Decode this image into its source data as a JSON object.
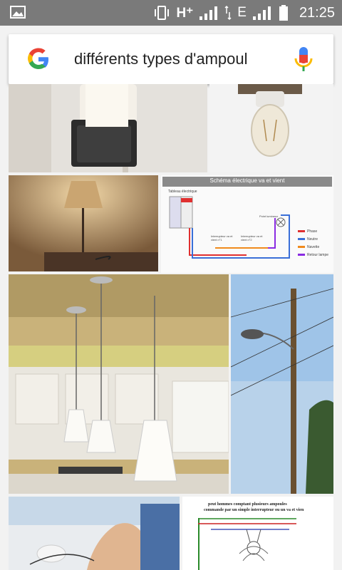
{
  "status_bar": {
    "network_label": "H⁺",
    "network_label2": "E",
    "time": "21:25",
    "icons": [
      "gallery-notification-icon",
      "vibrate-icon",
      "signal-icon",
      "data-arrows-icon",
      "battery-icon"
    ]
  },
  "search": {
    "query": "différents types d'ampoul",
    "logo_icon": "google-g-icon",
    "voice_icon": "microphone-icon"
  },
  "results": {
    "diagram1": {
      "title": "Schéma électrique va et vient",
      "panel_label": "Tableau électrique",
      "point_label": "Point lumineux",
      "switch1_label": "Interrupteur va et vient n°1",
      "switch2_label": "Interrupteur va et vient n°2",
      "legend": [
        "Phase",
        "Neutre",
        "Navette",
        "Retour lampe"
      ],
      "legend_colors": [
        "#e03030",
        "#3a6fd8",
        "#f08a1c",
        "#8a2be2"
      ]
    },
    "diagram2": {
      "caption_line1": "peut hommes comptant plusieurs ampoules",
      "caption_line2": "commande par un simple interrupteur ou un va et vien"
    }
  }
}
